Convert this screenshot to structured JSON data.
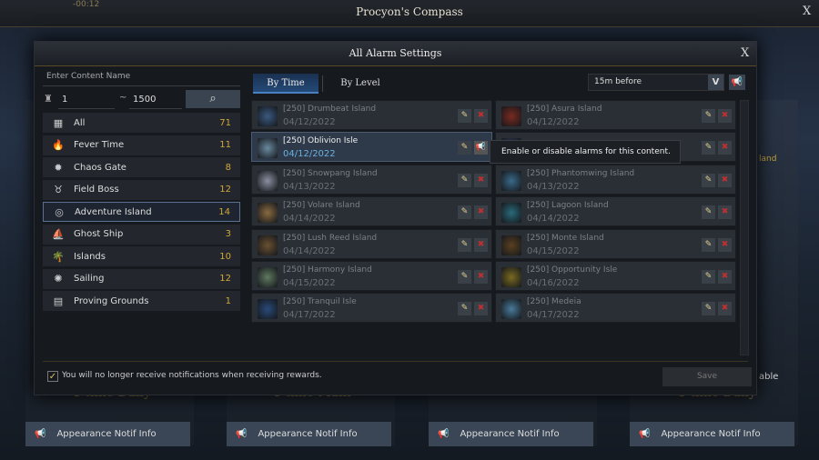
{
  "window": {
    "title": "Procyon's Compass",
    "timer": "-00:12",
    "close": "X"
  },
  "background": {
    "text_land": "land",
    "text_able": "able",
    "daily_1": "1 time Daily",
    "main": "1 time Main",
    "daily_2": "1 time Daily"
  },
  "dialog": {
    "title": "All Alarm Settings",
    "close": "X",
    "search_placeholder": "Enter Content Name",
    "level_min": "1",
    "level_sep": "~",
    "level_max": "1500",
    "categories": [
      {
        "label": "All",
        "count": "71",
        "icon": "grid-icon"
      },
      {
        "label": "Fever Time",
        "count": "11",
        "icon": "flame-icon"
      },
      {
        "label": "Chaos Gate",
        "count": "8",
        "icon": "gear-icon"
      },
      {
        "label": "Field Boss",
        "count": "12",
        "icon": "horns-icon"
      },
      {
        "label": "Adventure Island",
        "count": "14",
        "icon": "compass-icon",
        "selected": true
      },
      {
        "label": "Ghost Ship",
        "count": "3",
        "icon": "ship-icon"
      },
      {
        "label": "Islands",
        "count": "10",
        "icon": "palm-icon"
      },
      {
        "label": "Sailing",
        "count": "12",
        "icon": "sun-icon"
      },
      {
        "label": "Proving Grounds",
        "count": "1",
        "icon": "arena-icon"
      }
    ],
    "tabs": [
      {
        "label": "By Time",
        "active": true
      },
      {
        "label": "By Level"
      }
    ],
    "timing_dropdown": "15m before",
    "left_list": [
      {
        "name": "[250] Drumbeat Island",
        "date": "04/12/2022"
      },
      {
        "name": "[250] Oblivion Isle",
        "date": "04/12/2022",
        "highlighted": true
      },
      {
        "name": "[250] Snowpang Island",
        "date": "04/13/2022"
      },
      {
        "name": "[250] Volare Island",
        "date": "04/14/2022"
      },
      {
        "name": "[250] Lush Reed Island",
        "date": "04/14/2022"
      },
      {
        "name": "[250] Harmony Island",
        "date": "04/15/2022"
      },
      {
        "name": "[250] Tranquil Isle",
        "date": "04/17/2022"
      }
    ],
    "right_list": [
      {
        "name": "[250] Asura Island",
        "date": "04/12/2022"
      },
      {
        "name": "",
        "date": ""
      },
      {
        "name": "[250] Phantomwing Island",
        "date": "04/13/2022"
      },
      {
        "name": "[250] Lagoon Island",
        "date": "04/14/2022"
      },
      {
        "name": "[250] Monte Island",
        "date": "04/15/2022"
      },
      {
        "name": "[250] Opportunity Isle",
        "date": "04/16/2022"
      },
      {
        "name": "[250] Medeia",
        "date": "04/17/2022"
      }
    ],
    "tooltip": "Enable or disable alarms for this content.",
    "checkbox_label": "You will no longer receive notifications when receiving rewards.",
    "checkbox_checked": true,
    "save": "Save"
  },
  "appearance_buttons": [
    "Appearance Notif Info",
    "Appearance Notif Info",
    "Appearance Notif Info",
    "Appearance Notif Info"
  ]
}
